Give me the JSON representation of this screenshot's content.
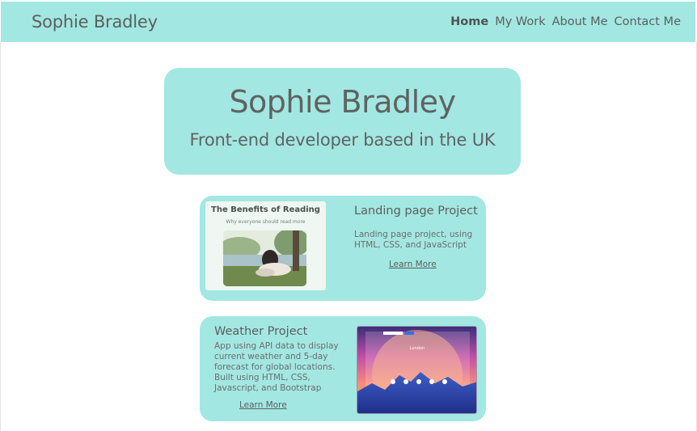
{
  "nav": {
    "brand": "Sophie Bradley",
    "links": [
      "Home",
      "My Work",
      "About Me",
      "Contact Me"
    ]
  },
  "hero": {
    "title": "Sophie Bradley",
    "subtitle": "Front-end developer based in the UK"
  },
  "projects": [
    {
      "title": "Landing page Project",
      "description_lines": [
        "Landing page project, using",
        "HTML, CSS, and JavaScript"
      ],
      "link": "Learn More",
      "thumbnail": {
        "title": "The Benefits of Reading",
        "subtitle": "Why everyone should read more"
      }
    },
    {
      "title": "Weather Project",
      "description_lines": [
        "App using API data to display",
        "current weather and 5-day",
        "forecast for global locations.",
        "Built using HTML, CSS,",
        "Javascript, and Bootstrap"
      ],
      "link": "Learn More",
      "thumbnail": {
        "city": "London"
      }
    }
  ],
  "colors": {
    "accent": "#a3e7e2",
    "text": "#5f6361",
    "background": "#ffffff"
  }
}
